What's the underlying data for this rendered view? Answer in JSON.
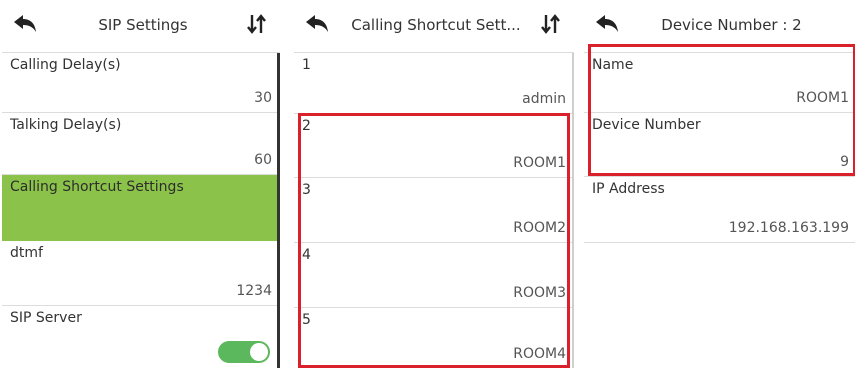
{
  "colors": {
    "highlight": "#8bc34a",
    "toggle_on": "#5cb85c",
    "annotation_red": "#d9202b"
  },
  "panel1": {
    "title": "SIP Settings",
    "back_icon": "back-arrow-icon",
    "sort_icon": "sort-arrows-icon",
    "rows": [
      {
        "label": "Calling Delay(s)",
        "value": "30"
      },
      {
        "label": "Talking Delay(s)",
        "value": "60"
      },
      {
        "label": "Calling Shortcut Settings",
        "value": ""
      },
      {
        "label": "dtmf",
        "value": "1234"
      },
      {
        "label": "SIP Server",
        "toggle": true
      }
    ]
  },
  "panel2": {
    "title": "Calling Shortcut Sett...",
    "rows": [
      {
        "label": "1",
        "value": "admin"
      },
      {
        "label": "2",
        "value": "ROOM1"
      },
      {
        "label": "3",
        "value": "ROOM2"
      },
      {
        "label": "4",
        "value": "ROOM3"
      },
      {
        "label": "5",
        "value": "ROOM4"
      }
    ]
  },
  "panel3": {
    "title": "Device Number : 2",
    "rows": [
      {
        "label": "Name",
        "value": "ROOM1"
      },
      {
        "label": "Device Number",
        "value": "9"
      },
      {
        "label": "IP Address",
        "value": "192.168.163.199"
      }
    ]
  }
}
